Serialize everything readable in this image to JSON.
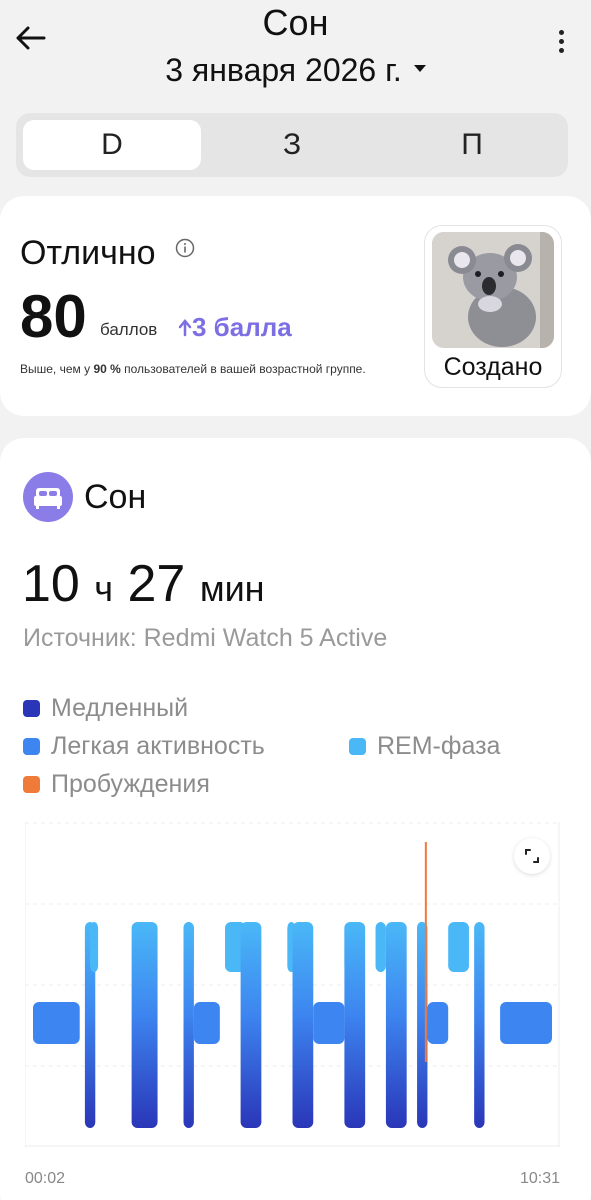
{
  "header": {
    "title": "Сон",
    "date": "3 января 2026 г."
  },
  "tabs": [
    {
      "label": "D",
      "active": true
    },
    {
      "label": "З",
      "active": false
    },
    {
      "label": "П",
      "active": false
    }
  ],
  "score_card": {
    "rating": "Отлично",
    "score": "80",
    "score_unit": "баллов",
    "delta": "3 балла",
    "note_prefix": "Выше, чем у ",
    "note_percent": "90 %",
    "note_suffix": " пользователей в вашей возрастной группе.",
    "badge_label": "Создано"
  },
  "sleep": {
    "title": "Сон",
    "hours": "10",
    "hours_unit": "ч",
    "minutes": "27",
    "minutes_unit": "мин",
    "source": "Источник: Redmi Watch 5 Active",
    "legend": [
      {
        "label": "Медленный",
        "color": "#2a36b8"
      },
      {
        "label": "Легкая активность",
        "color": "#3d85f0"
      },
      {
        "label": "REM-фаза",
        "color": "#4ab8f7"
      },
      {
        "label": "Пробуждения",
        "color": "#f07a3a"
      }
    ]
  },
  "chart_data": {
    "type": "area",
    "x_start": "00:02",
    "x_end": "10:31",
    "stages": [
      "Пробуждения",
      "REM-фаза",
      "Легкая активность",
      "Медленный"
    ],
    "segments": [
      {
        "stage": "Легкая активность",
        "start": 0.0,
        "end": 0.09
      },
      {
        "stage": "Медленный",
        "start": 0.1,
        "end": 0.12
      },
      {
        "stage": "REM-фаза",
        "start": 0.11,
        "end": 0.12
      },
      {
        "stage": "Медленный",
        "start": 0.19,
        "end": 0.24
      },
      {
        "stage": "REM-фаза",
        "start": 0.29,
        "end": 0.31
      },
      {
        "stage": "Медленный",
        "start": 0.29,
        "end": 0.31
      },
      {
        "stage": "Легкая активность",
        "start": 0.31,
        "end": 0.36
      },
      {
        "stage": "REM-фаза",
        "start": 0.37,
        "end": 0.41
      },
      {
        "stage": "Медленный",
        "start": 0.4,
        "end": 0.44
      },
      {
        "stage": "REM-фаза",
        "start": 0.49,
        "end": 0.5
      },
      {
        "stage": "Медленный",
        "start": 0.5,
        "end": 0.54
      },
      {
        "stage": "Легкая активность",
        "start": 0.54,
        "end": 0.6
      },
      {
        "stage": "REM-фаза",
        "start": 0.6,
        "end": 0.63
      },
      {
        "stage": "Медленный",
        "start": 0.6,
        "end": 0.64
      },
      {
        "stage": "REM-фаза",
        "start": 0.66,
        "end": 0.68
      },
      {
        "stage": "Медленный",
        "start": 0.68,
        "end": 0.72
      },
      {
        "stage": "REM-фаза",
        "start": 0.74,
        "end": 0.75
      },
      {
        "stage": "Медленный",
        "start": 0.74,
        "end": 0.76
      },
      {
        "stage": "Пробуждения",
        "start": 0.755,
        "end": 0.758
      },
      {
        "stage": "Легкая активность",
        "start": 0.76,
        "end": 0.8
      },
      {
        "stage": "REM-фаза",
        "start": 0.8,
        "end": 0.84
      },
      {
        "stage": "Медленный",
        "start": 0.85,
        "end": 0.87
      },
      {
        "stage": "Легкая активность",
        "start": 0.9,
        "end": 1.0
      }
    ]
  }
}
